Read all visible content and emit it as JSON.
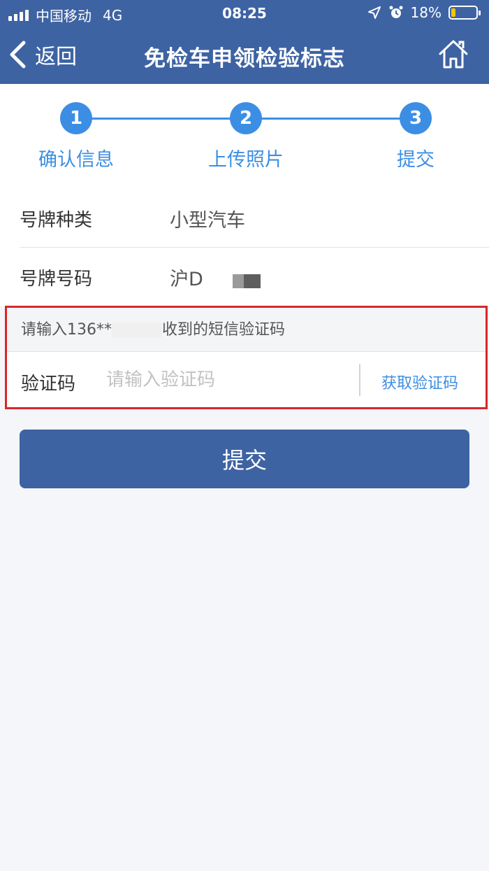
{
  "status_bar": {
    "carrier": "中国移动",
    "network": "4G",
    "time": "08:25",
    "battery": "18%",
    "battery_level": 0.18
  },
  "header": {
    "back_label": "返回",
    "title": "免检车申领检验标志",
    "home_icon": "home-icon"
  },
  "steps": [
    {
      "number": "1",
      "label": "确认信息"
    },
    {
      "number": "2",
      "label": "上传照片"
    },
    {
      "number": "3",
      "label": "提交"
    }
  ],
  "form": {
    "plate_type_label": "号牌种类",
    "plate_type_value": "小型汽车",
    "plate_number_label": "号牌号码",
    "plate_number_value": "沪D"
  },
  "verify": {
    "hint_prefix": "请输入136**",
    "hint_suffix": "收到的短信验证码",
    "code_label": "验证码",
    "code_placeholder": "请输入验证码",
    "get_code_label": "获取验证码"
  },
  "submit_label": "提交",
  "colors": {
    "header_bg": "#3e63a3",
    "accent": "#3c8ee4",
    "highlight_border": "#d9262a"
  }
}
